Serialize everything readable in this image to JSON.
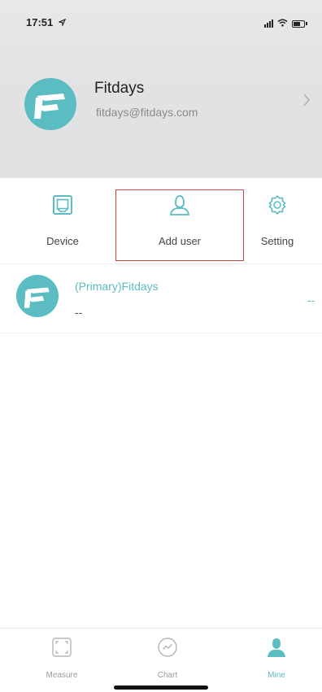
{
  "status_bar": {
    "time": "17:51"
  },
  "profile": {
    "name": "Fitdays",
    "email": "fitdays@fitdays.com"
  },
  "actions": {
    "device": "Device",
    "add_user": "Add  user",
    "setting": "Setting"
  },
  "users": [
    {
      "name": "(Primary)Fitdays",
      "sub": "--",
      "value": "--"
    }
  ],
  "tabbar": {
    "measure": "Measure",
    "chart": "Chart",
    "mine": "Mine"
  },
  "colors": {
    "accent": "#5bbcc1",
    "highlight_border": "#c9473f",
    "header_bg": "#e3e3e5"
  },
  "icons": {
    "status": [
      "location-arrow-icon",
      "signal-icon",
      "wifi-icon",
      "battery-icon"
    ],
    "profile_chevron": "chevron-right-icon",
    "device": "device-icon",
    "add_user": "person-icon",
    "setting": "gear-icon",
    "tab_measure": "measure-frame-icon",
    "tab_chart": "chart-circle-icon",
    "tab_mine": "person-filled-icon"
  }
}
